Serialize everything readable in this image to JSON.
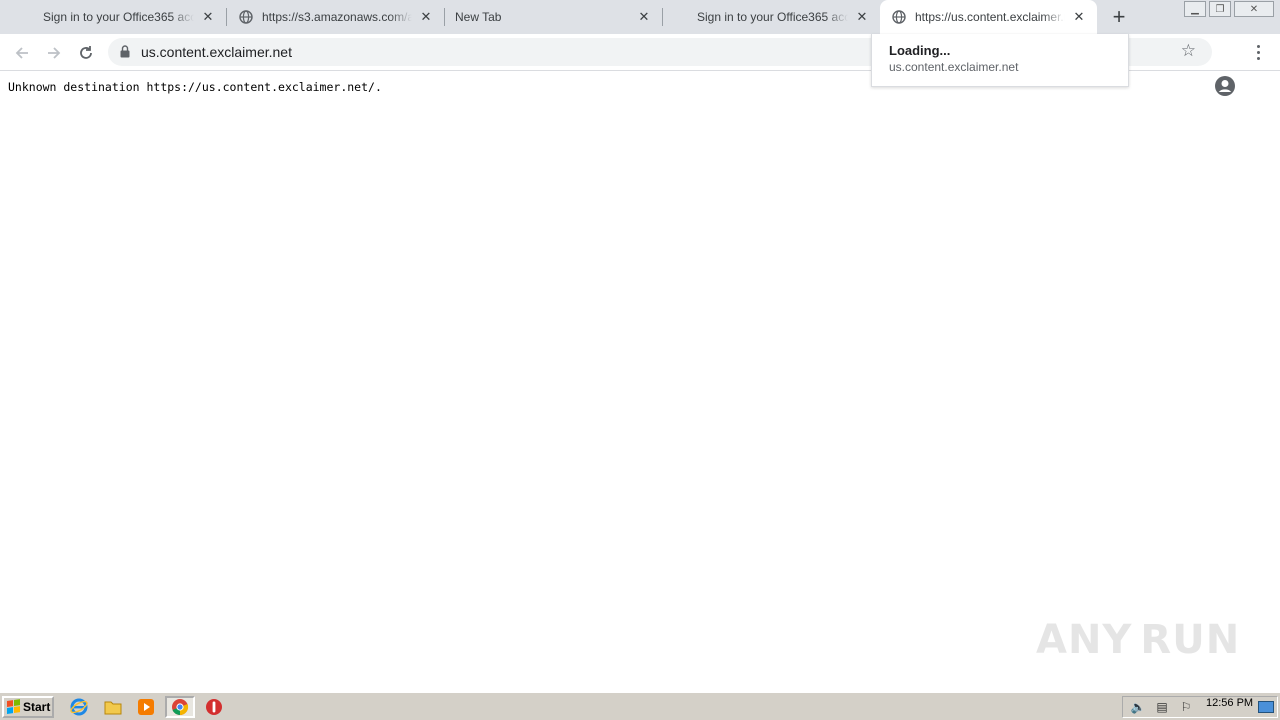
{
  "tabs": [
    {
      "title": "Sign in to your Office365 account",
      "favicon": "microsoft-logo",
      "active": false
    },
    {
      "title": "https://s3.amazonaws.com/app",
      "favicon": "globe-icon",
      "active": false
    },
    {
      "title": "New Tab",
      "favicon": "",
      "active": false
    },
    {
      "title": "Sign in to your Office365 account",
      "favicon": "microsoft-logo",
      "active": false
    },
    {
      "title": "https://us.content.exclaimer.net",
      "favicon": "globe-icon",
      "active": true
    }
  ],
  "toolbar": {
    "url": "us.content.exclaimer.net"
  },
  "hovercard": {
    "status": "Loading...",
    "host": "us.content.exclaimer.net"
  },
  "page": {
    "message": "Unknown destination https://us.content.exclaimer.net/."
  },
  "watermark": {
    "left": "ANY",
    "right": "RUN"
  },
  "taskbar": {
    "start_label": "Start",
    "clock": "12:56 PM",
    "pinned": [
      "internet-explorer-icon",
      "file-explorer-icon",
      "media-player-icon",
      "chrome-icon",
      "antivirus-icon"
    ]
  },
  "colors": {
    "tabstrip": "#dee1e6",
    "omnibox": "#f1f3f4",
    "taskbar": "#d4d0c8"
  }
}
